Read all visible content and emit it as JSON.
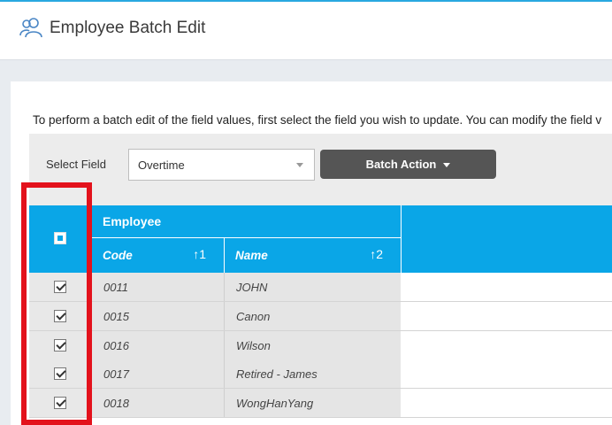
{
  "header": {
    "title": "Employee Batch Edit",
    "icon": "users-icon"
  },
  "instructions": "To perform a batch edit of the field values, first select the field you wish to update. You can modify the field v",
  "toolbar": {
    "select_label": "Select Field",
    "select_value": "Overtime",
    "batch_button_label": "Batch Action"
  },
  "table": {
    "group_header": "Employee",
    "columns": [
      {
        "label": "Code",
        "sort": "↑1"
      },
      {
        "label": "Name",
        "sort": "↑2"
      }
    ],
    "rows": [
      {
        "code": "0011",
        "name": "JOHN",
        "checked": true
      },
      {
        "code": "0015",
        "name": "Canon",
        "checked": true
      },
      {
        "code": "0016",
        "name": "Wilson",
        "checked": true
      },
      {
        "code": "0017",
        "name": "Retired - James",
        "checked": true
      },
      {
        "code": "0018",
        "name": "WongHanYang",
        "checked": true
      }
    ]
  },
  "colors": {
    "accent": "#0aa6e7",
    "highlight": "#e3121c",
    "button": "#555555"
  }
}
